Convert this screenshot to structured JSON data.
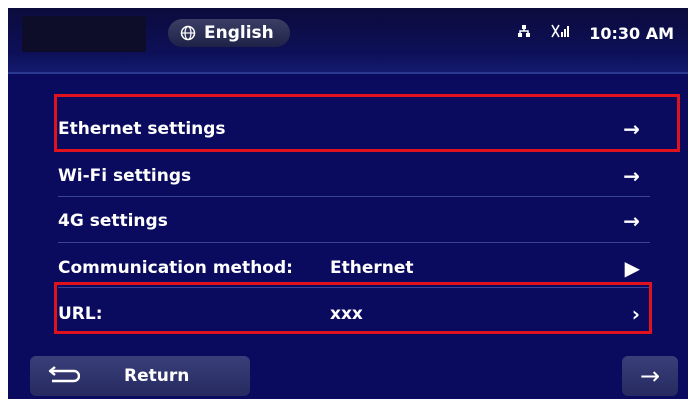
{
  "status_bar": {
    "language": "English",
    "time": "10:30 AM",
    "icons": [
      "network-icon",
      "no-signal-icon"
    ]
  },
  "menu": {
    "items": [
      {
        "label": "Ethernet settings",
        "value": "",
        "arrow": "→"
      },
      {
        "label": "Wi-Fi settings",
        "value": "",
        "arrow": "→"
      },
      {
        "label": "4G settings",
        "value": "",
        "arrow": "→"
      },
      {
        "label": "Communication method:",
        "value": "Ethernet",
        "arrow": "▶"
      },
      {
        "label": "URL:",
        "value": "xxx",
        "arrow": "›"
      }
    ]
  },
  "footer": {
    "return_label": "Return",
    "next_arrow": "→"
  },
  "colors": {
    "background": "#0a0a5e",
    "highlight": "#e0121e",
    "text": "#ffffff"
  }
}
